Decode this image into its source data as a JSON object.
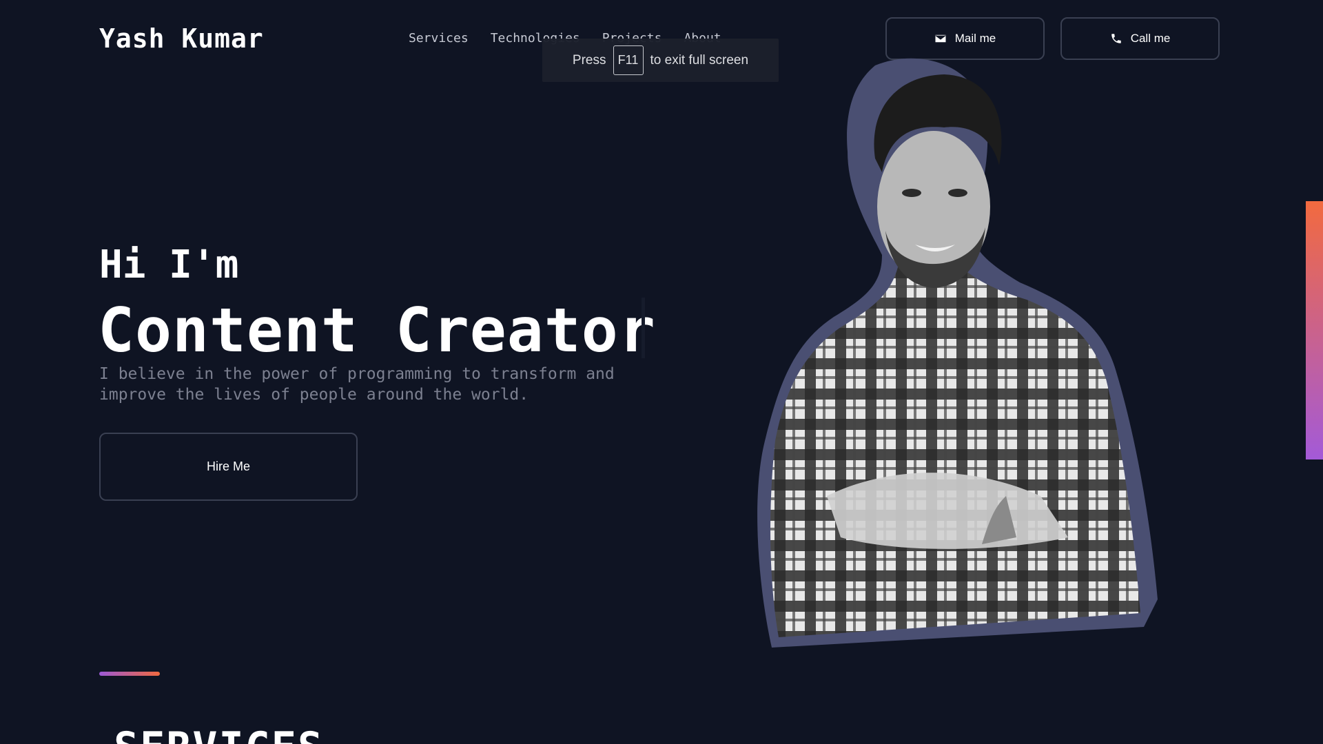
{
  "header": {
    "logo": "Yash Kumar",
    "nav": [
      "Services",
      "Technologies",
      "Projects",
      "About"
    ],
    "mail_label": "Mail me",
    "call_label": "Call me",
    "mail_icon": "envelope-icon",
    "call_icon": "phone-icon"
  },
  "fullscreen_notice": {
    "prefix": "Press",
    "key": "F11",
    "suffix": "to exit full screen"
  },
  "hero": {
    "greeting": "Hi I'm",
    "role": "Content Creator",
    "tagline": "I believe in the power of programming to transform and improve the lives of people around the world.",
    "cta_label": "Hire Me",
    "portrait": "grayscale-portrait-photo"
  },
  "services_section": {
    "title": "SERVICES"
  },
  "colors": {
    "background": "#0f1423",
    "accent_orange": "#f26a3f",
    "accent_purple": "#a35ad8",
    "portrait_outline": "#4a4f72",
    "button_border": "#3a4052"
  }
}
